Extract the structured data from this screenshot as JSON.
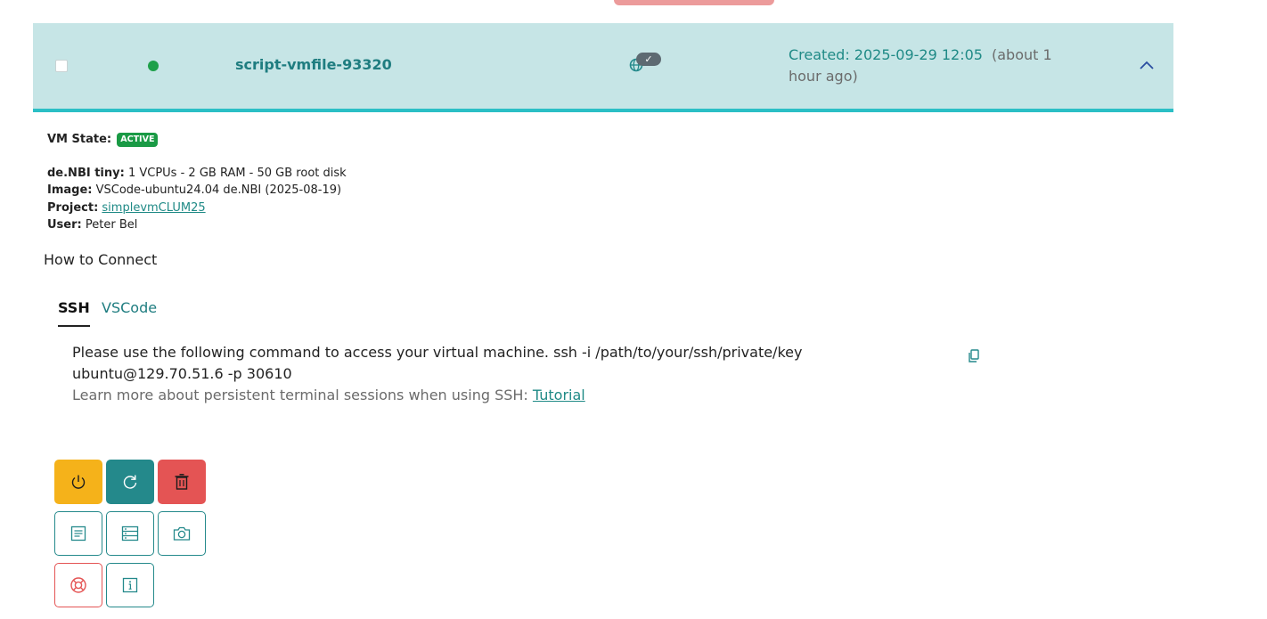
{
  "vm": {
    "name": "script-vmfile-93320",
    "created_label": "Created: 2025-09-29 12:05",
    "created_ago": "(about 1 hour ago)",
    "check_symbol": "✓",
    "status_color": "#1ea04a"
  },
  "details": {
    "state_label": "VM State:",
    "state_value": "ACTIVE",
    "flavor_label": "de.NBI tiny:",
    "flavor_value": "1 VCPUs - 2 GB RAM - 50 GB root disk",
    "image_label": "Image:",
    "image_value": "VSCode-ubuntu24.04 de.NBI (2025-08-19)",
    "project_label": "Project:",
    "project_value": "simplevmCLUM25",
    "user_label": "User:",
    "user_value": "Peter Bel"
  },
  "connect": {
    "heading": "How to Connect",
    "tabs": [
      "SSH",
      "VSCode"
    ],
    "ssh_text": "Please use the following command to access your virtual machine. ssh -i /path/to/your/ssh/private/key ubuntu@129.70.51.6 -p 30610",
    "learn_text": "Learn more about persistent terminal sessions when using SSH:",
    "tutorial_link": "Tutorial"
  },
  "actions": {
    "icons": [
      "power-icon",
      "restart-icon",
      "trash-icon",
      "logs-icon",
      "volumes-icon",
      "camera-icon",
      "lifebuoy-icon",
      "info-icon"
    ]
  },
  "colors": {
    "accent": "#24898b",
    "row_bg": "#c6e5e6",
    "warning": "#f5b21a",
    "danger": "#e45454",
    "success": "#1a9a45"
  }
}
